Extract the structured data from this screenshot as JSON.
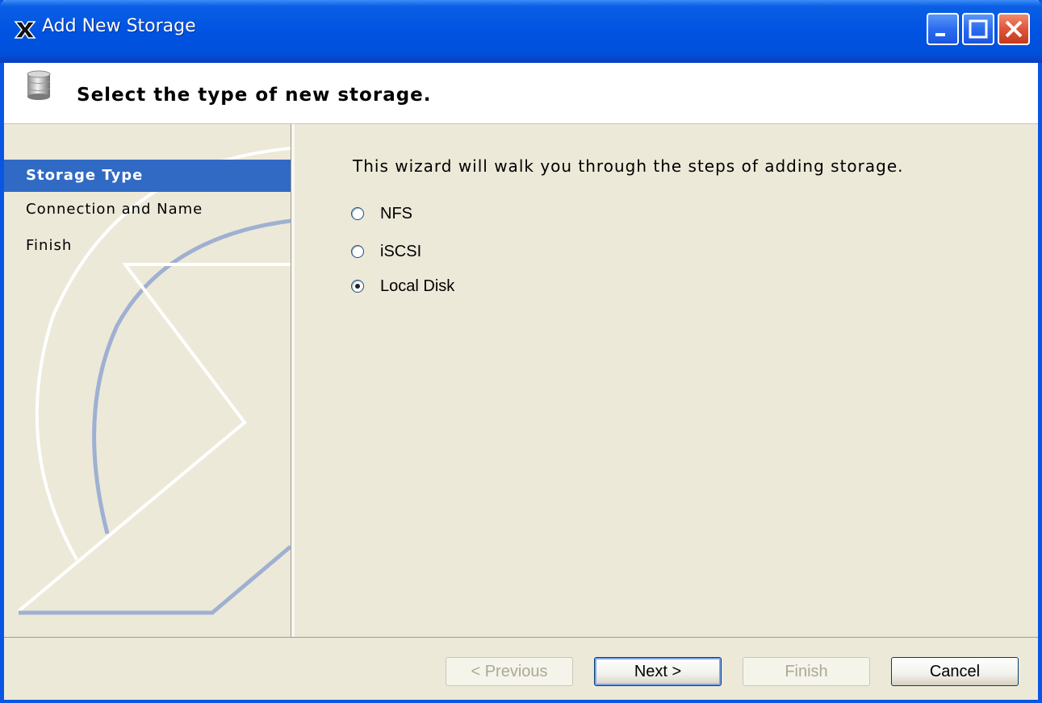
{
  "window": {
    "title": "Add New Storage",
    "controls": [
      "minimize",
      "maximize",
      "close"
    ]
  },
  "header": {
    "title": "Select the type of new storage.",
    "icon": "database-icon"
  },
  "sidebar": {
    "steps": [
      {
        "label": "Storage Type",
        "active": true
      },
      {
        "label": "Connection and Name",
        "active": false
      },
      {
        "label": "Finish",
        "active": false
      }
    ]
  },
  "main": {
    "intro": "This wizard will walk you through the steps of adding storage.",
    "options": [
      {
        "label": "NFS",
        "checked": false
      },
      {
        "label": "iSCSI",
        "checked": false
      },
      {
        "label": "Local Disk",
        "checked": true
      }
    ]
  },
  "footer": {
    "previous_label": "< Previous",
    "next_label": "Next >",
    "finish_label": "Finish",
    "cancel_label": "Cancel"
  },
  "colors": {
    "titlebar": "#0053e1",
    "active_step": "#316ac5",
    "background": "#ece9d8"
  }
}
